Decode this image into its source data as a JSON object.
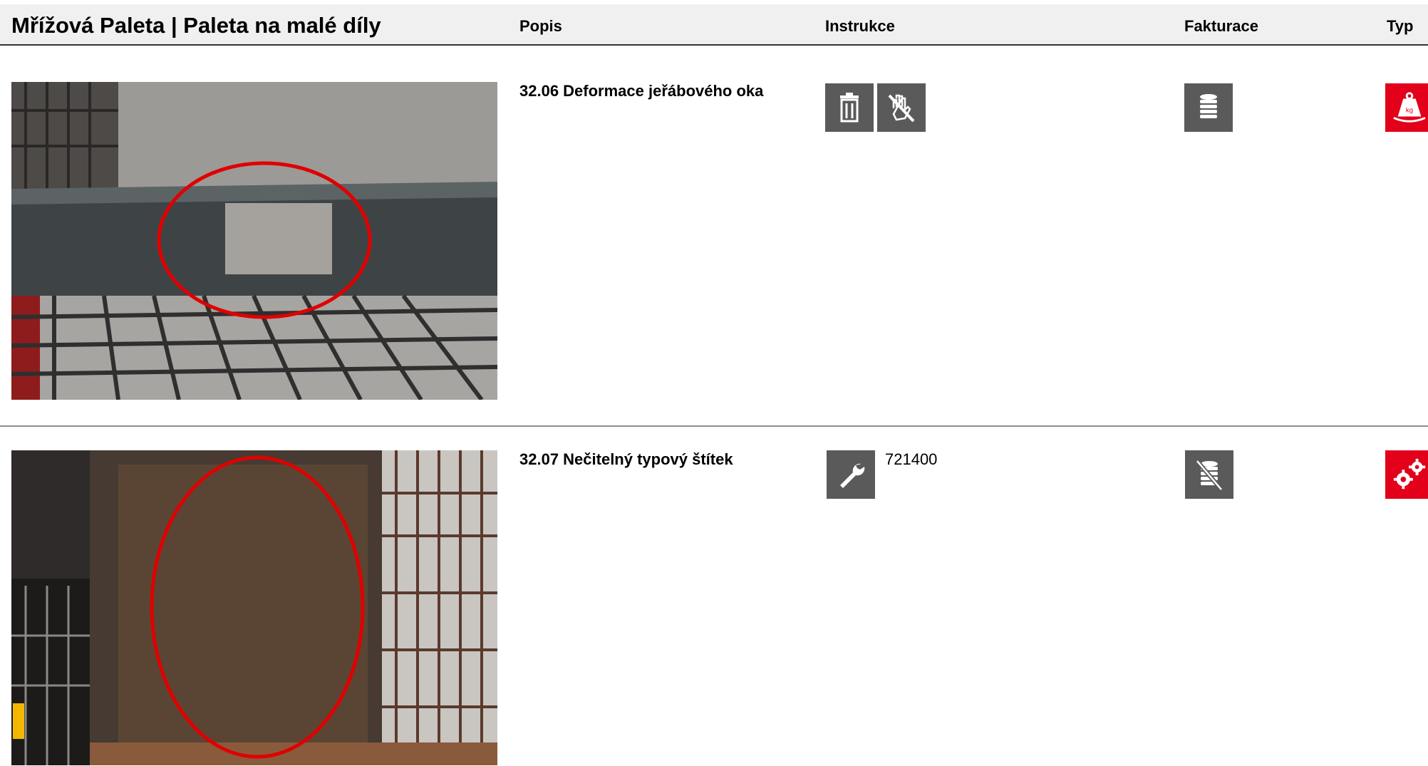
{
  "header": {
    "title": "Mřížová Paleta | Paleta na malé díly",
    "columns": {
      "popis": "Popis",
      "instrukce": "Instrukce",
      "fakturace": "Fakturace",
      "typ": "Typ"
    }
  },
  "rows": [
    {
      "description": "32.06 Deformace jeřábového oka",
      "instructions": [
        "trash-icon",
        "no-touch-icon"
      ],
      "code": "",
      "billing": "coins-icon",
      "type": "weight-icon"
    },
    {
      "description": "32.07 Nečitelný typový štítek",
      "instructions": [
        "wrench-icon"
      ],
      "code": "721400",
      "billing": "no-coins-icon",
      "type": "gears-icon"
    }
  ],
  "colors": {
    "icon_gray": "#5a5a5a",
    "type_red": "#e2001a",
    "header_bg": "#f0f0f0",
    "mark_circle": "#e00000"
  }
}
